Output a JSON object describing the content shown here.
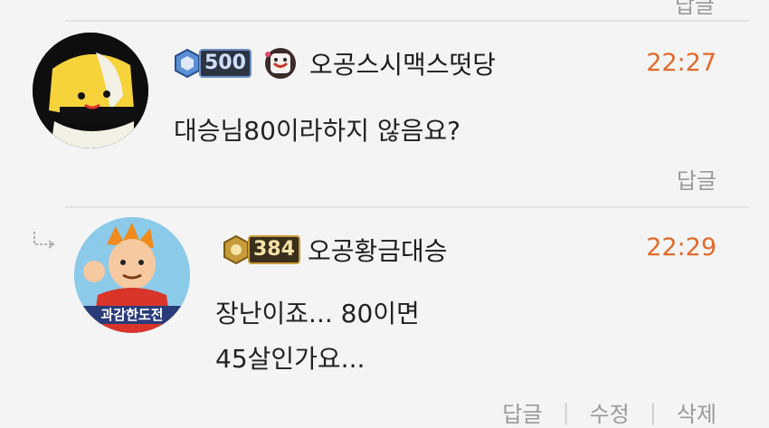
{
  "top": {
    "reply_label": "답글"
  },
  "comment1": {
    "level": "500",
    "nickname": "오공스시맥스떳당",
    "time": "22:27",
    "text": "대승님80이라하지 않음요?",
    "reply_label": "답글",
    "colors": {
      "time": "#e06b2c"
    }
  },
  "comment2": {
    "level": "384",
    "nickname": "오공황금대승",
    "time": "22:29",
    "text_lines": [
      "장난이죠... 80이면",
      "45살인가요..."
    ],
    "avatar_text": "과감한도전",
    "actions": {
      "reply": "답글",
      "edit": "수정",
      "delete": "삭제"
    }
  }
}
